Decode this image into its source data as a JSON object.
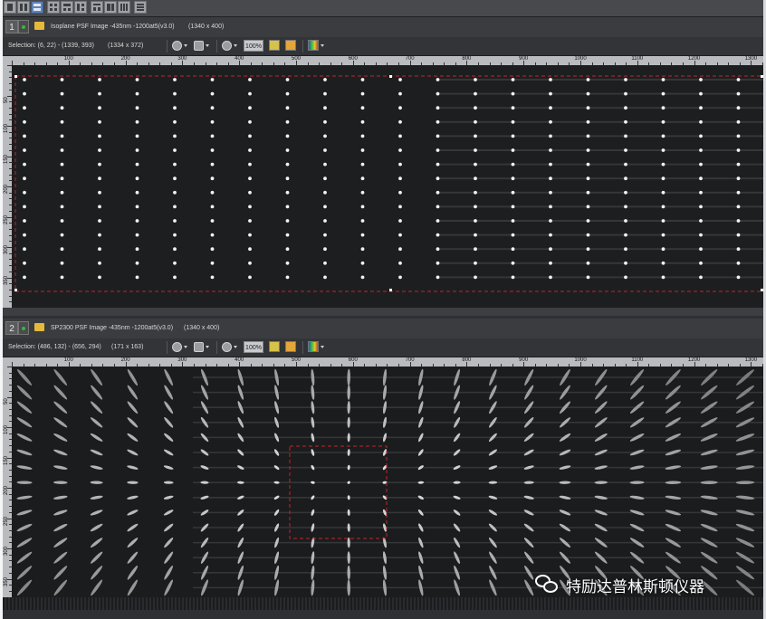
{
  "topbar": {
    "layout_buttons": [
      "layout-single",
      "layout-two-horizontal",
      "layout-two-vertical",
      "layout-grid",
      "layout-three",
      "layout-four",
      "layout-strips"
    ],
    "active_index": 2
  },
  "panes": [
    {
      "number": "1",
      "title": "Isoplane PSF Image -435nm -1200at5(v3.0)",
      "dims": "(1340 x 400)",
      "selection": "Selection: (6, 22) - (1339, 393)",
      "selection_size": "(1334 x 372)",
      "zoom": "100%",
      "ruler_x": [
        "100",
        "200",
        "300",
        "400",
        "500",
        "600",
        "700",
        "800",
        "900",
        "1000",
        "1100",
        "1200",
        "1300"
      ],
      "ruler_y": [
        "50",
        "100",
        "150",
        "200",
        "250",
        "300",
        "350"
      ]
    },
    {
      "number": "2",
      "title": "SP2300 PSF Image -435nm -1200at5(v3.0)",
      "dims": "(1340 x 400)",
      "selection": "Selection: (486, 132) - (656, 294)",
      "selection_size": "(171 x 163)",
      "zoom": "100%",
      "ruler_x": [
        "100",
        "200",
        "300",
        "400",
        "500",
        "600",
        "700",
        "800",
        "900",
        "1000",
        "1100",
        "1200",
        "1300"
      ],
      "ruler_y": [
        "50",
        "100",
        "150",
        "200",
        "250",
        "300",
        "350"
      ]
    }
  ],
  "watermark": {
    "text": "特励达普林斯顿仪器",
    "icon": "wechat-icon"
  },
  "colors": {
    "accent": "#5f83b8",
    "selection_dash": "#c0262b",
    "folder": "#e5b93a"
  }
}
